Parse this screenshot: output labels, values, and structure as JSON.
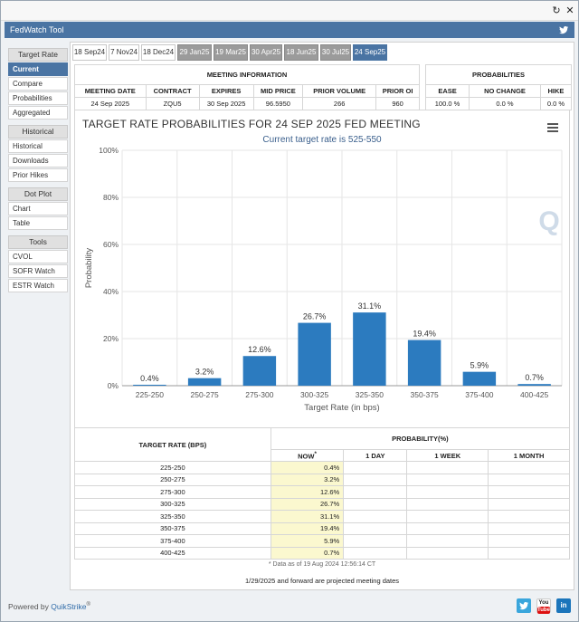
{
  "app": {
    "title": "FedWatch Tool"
  },
  "sidebar": {
    "sections": [
      {
        "header": "Target Rate",
        "items": [
          {
            "label": "Current",
            "active": true
          },
          {
            "label": "Compare"
          },
          {
            "label": "Probabilities"
          },
          {
            "label": "Aggregated"
          }
        ]
      },
      {
        "header": "Historical",
        "items": [
          {
            "label": "Historical"
          },
          {
            "label": "Downloads"
          },
          {
            "label": "Prior Hikes"
          }
        ]
      },
      {
        "header": "Dot Plot",
        "items": [
          {
            "label": "Chart"
          },
          {
            "label": "Table"
          }
        ]
      },
      {
        "header": "Tools",
        "items": [
          {
            "label": "CVOL"
          },
          {
            "label": "SOFR Watch"
          },
          {
            "label": "ESTR Watch"
          }
        ]
      }
    ]
  },
  "tabs": [
    {
      "label": "18 Sep24",
      "style": "white"
    },
    {
      "label": "7 Nov24",
      "style": "white"
    },
    {
      "label": "18 Dec24",
      "style": "white"
    },
    {
      "label": "29 Jan25",
      "style": "grey"
    },
    {
      "label": "19 Mar25",
      "style": "grey"
    },
    {
      "label": "30 Apr25",
      "style": "grey"
    },
    {
      "label": "18 Jun25",
      "style": "grey"
    },
    {
      "label": "30 Jul25",
      "style": "grey"
    },
    {
      "label": "24 Sep25",
      "style": "active"
    }
  ],
  "meeting_info": {
    "header": "MEETING INFORMATION",
    "columns": [
      "MEETING DATE",
      "CONTRACT",
      "EXPIRES",
      "MID PRICE",
      "PRIOR VOLUME",
      "PRIOR OI"
    ],
    "values": [
      "24 Sep 2025",
      "ZQU5",
      "30 Sep 2025",
      "96.5950",
      "266",
      "960"
    ]
  },
  "probabilities": {
    "header": "PROBABILITIES",
    "columns": [
      "EASE",
      "NO CHANGE",
      "HIKE"
    ],
    "values": [
      "100.0 %",
      "0.0 %",
      "0.0 %"
    ]
  },
  "chart_data": {
    "type": "bar",
    "title": "TARGET RATE PROBABILITIES FOR 24 SEP 2025 FED MEETING",
    "subtitle": "Current target rate is 525-550",
    "xlabel": "Target Rate (in bps)",
    "ylabel": "Probability",
    "ylim": [
      0,
      100
    ],
    "yticks": [
      "0%",
      "20%",
      "40%",
      "60%",
      "80%",
      "100%"
    ],
    "categories": [
      "225-250",
      "250-275",
      "275-300",
      "300-325",
      "325-350",
      "350-375",
      "375-400",
      "400-425"
    ],
    "values": [
      0.4,
      3.2,
      12.6,
      26.7,
      31.1,
      19.4,
      5.9,
      0.7
    ],
    "data_labels": [
      "0.4%",
      "3.2%",
      "12.6%",
      "26.7%",
      "31.1%",
      "19.4%",
      "5.9%",
      "0.7%"
    ],
    "bar_color": "#2c7bbf",
    "grid": true
  },
  "prob_table": {
    "col_rate": "TARGET RATE (BPS)",
    "col_prob": "PROBABILITY(%)",
    "sub_cols": [
      "NOW",
      "1 DAY",
      "1 WEEK",
      "1 MONTH"
    ],
    "now_marker": "*",
    "rows": [
      {
        "rate": "225-250",
        "now": "0.4%"
      },
      {
        "rate": "250-275",
        "now": "3.2%"
      },
      {
        "rate": "275-300",
        "now": "12.6%"
      },
      {
        "rate": "300-325",
        "now": "26.7%"
      },
      {
        "rate": "325-350",
        "now": "31.1%"
      },
      {
        "rate": "350-375",
        "now": "19.4%"
      },
      {
        "rate": "375-400",
        "now": "5.9%"
      },
      {
        "rate": "400-425",
        "now": "0.7%"
      }
    ],
    "note": "* Data as of 19 Aug 2024 12:56:14 CT",
    "note2": "1/29/2025 and forward are projected meeting dates"
  },
  "footer": {
    "powered_prefix": "Powered by",
    "powered_brand": "QuikStrike",
    "powered_reg": "®",
    "youtube_top": "You",
    "youtube_bottom": "Tube",
    "linkedin": "in"
  },
  "colors": {
    "accent": "#4a74a3",
    "bar": "#2c7bbf",
    "now_bg": "#fbf8cf"
  }
}
